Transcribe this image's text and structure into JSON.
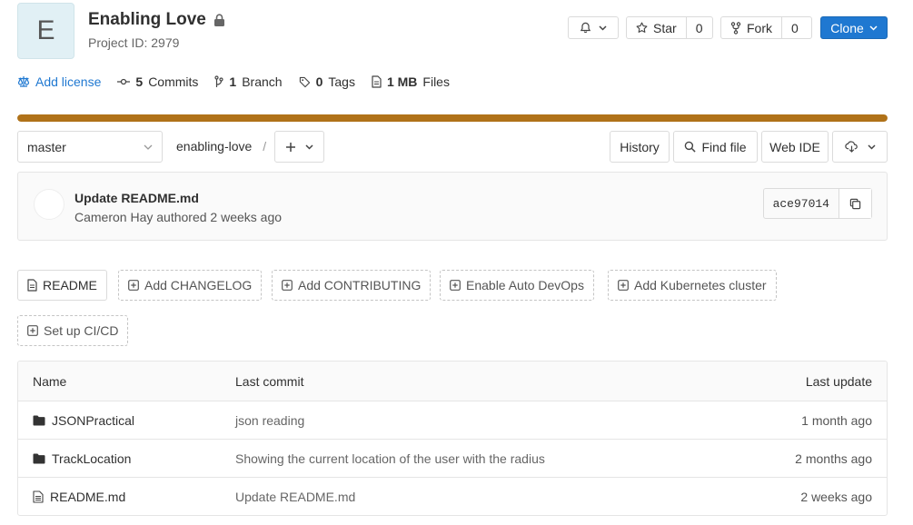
{
  "project": {
    "avatar_letter": "E",
    "name": "Enabling Love",
    "id_text": "Project ID: 2979"
  },
  "actions": {
    "star_label": "Star",
    "star_count": "0",
    "fork_label": "Fork",
    "fork_count": "0",
    "clone_label": "Clone"
  },
  "stats": {
    "license": "Add license",
    "commits_count": "5",
    "commits_label": "Commits",
    "branch_count": "1",
    "branch_label": "Branch",
    "tags_count": "0",
    "tags_label": "Tags",
    "files_size": "1 MB",
    "files_label": "Files"
  },
  "language_bar": {
    "fraction": 1.0,
    "color": "#b07219"
  },
  "repo_nav": {
    "branch": "master",
    "path_root": "enabling-love",
    "path_sep": "/",
    "history": "History",
    "find_file": "Find file",
    "web_ide": "Web IDE"
  },
  "last_commit": {
    "title": "Update README.md",
    "meta": "Cameron Hay authored 2 weeks ago",
    "sha": "ace97014"
  },
  "quick_actions": [
    {
      "label": "README"
    },
    {
      "label": "Add CHANGELOG"
    },
    {
      "label": "Add CONTRIBUTING"
    },
    {
      "label": "Enable Auto DevOps"
    },
    {
      "label": "Add Kubernetes cluster"
    },
    {
      "label": "Set up CI/CD"
    }
  ],
  "file_table": {
    "headers": {
      "name": "Name",
      "last_commit": "Last commit",
      "last_update": "Last update"
    },
    "rows": [
      {
        "icon": "folder-icon",
        "name": "JSONPractical",
        "commit": "json reading",
        "updated": "1 month ago"
      },
      {
        "icon": "folder-icon",
        "name": "TrackLocation",
        "commit": "Showing the current location of the user with the radius",
        "updated": "2 months ago"
      },
      {
        "icon": "file-icon",
        "name": "README.md",
        "commit": "Update README.md",
        "updated": "2 weeks ago"
      }
    ]
  },
  "colors": {
    "accent": "#1f78d1",
    "language": "#b07219"
  }
}
